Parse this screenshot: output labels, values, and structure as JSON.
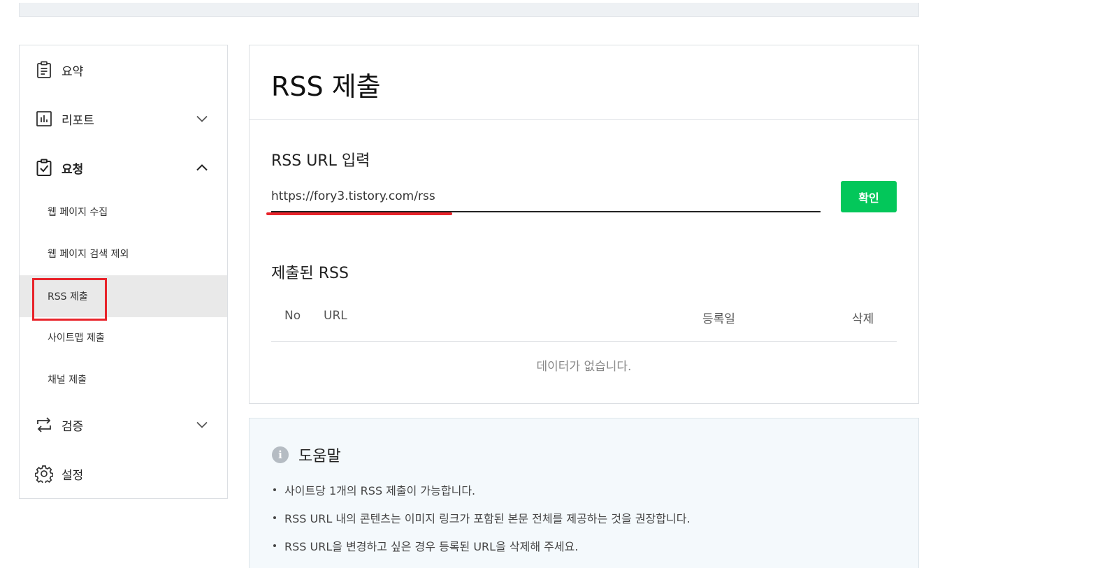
{
  "sidebar": {
    "items": [
      {
        "label": "요약",
        "icon": "clipboard-list-icon"
      },
      {
        "label": "리포트",
        "icon": "bar-chart-icon",
        "chevron": "chevron-down-icon"
      },
      {
        "label": "요청",
        "icon": "clipboard-check-icon",
        "chevron": "chevron-up-icon"
      },
      {
        "label": "검증",
        "icon": "repeat-arrows-icon",
        "chevron": "chevron-down-icon"
      },
      {
        "label": "설정",
        "icon": "gear-icon"
      }
    ],
    "subitems": [
      {
        "label": "웹 페이지 수집"
      },
      {
        "label": "웹 페이지 검색 제외"
      },
      {
        "label": "RSS 제출",
        "active": true
      },
      {
        "label": "사이트맵 제출"
      },
      {
        "label": "채널 제출"
      }
    ]
  },
  "main": {
    "title": "RSS 제출",
    "input_section_label": "RSS URL 입력",
    "url_value": "https://fory3.tistory.com/rss",
    "confirm_label": "확인",
    "submitted_label": "제출된 RSS",
    "table": {
      "headers": [
        "No",
        "URL",
        "등록일",
        "삭제"
      ],
      "empty_message": "데이터가 없습니다."
    }
  },
  "help": {
    "title": "도움말",
    "icon": "info-icon",
    "icon_glyph": "i",
    "items": [
      "사이트당 1개의 RSS 제출이 가능합니다.",
      "RSS URL 내의 콘텐츠는 이미지 링크가 포함된 본문 전체를 제공하는 것을 권장합니다.",
      "RSS URL을 변경하고 싶은 경우 등록된 URL을 삭제해 주세요."
    ]
  },
  "colors": {
    "accent_green": "#03c75a",
    "highlight_red": "#e8232a",
    "help_background": "#f4f9fc",
    "active_item_background": "#e9e9e9"
  }
}
